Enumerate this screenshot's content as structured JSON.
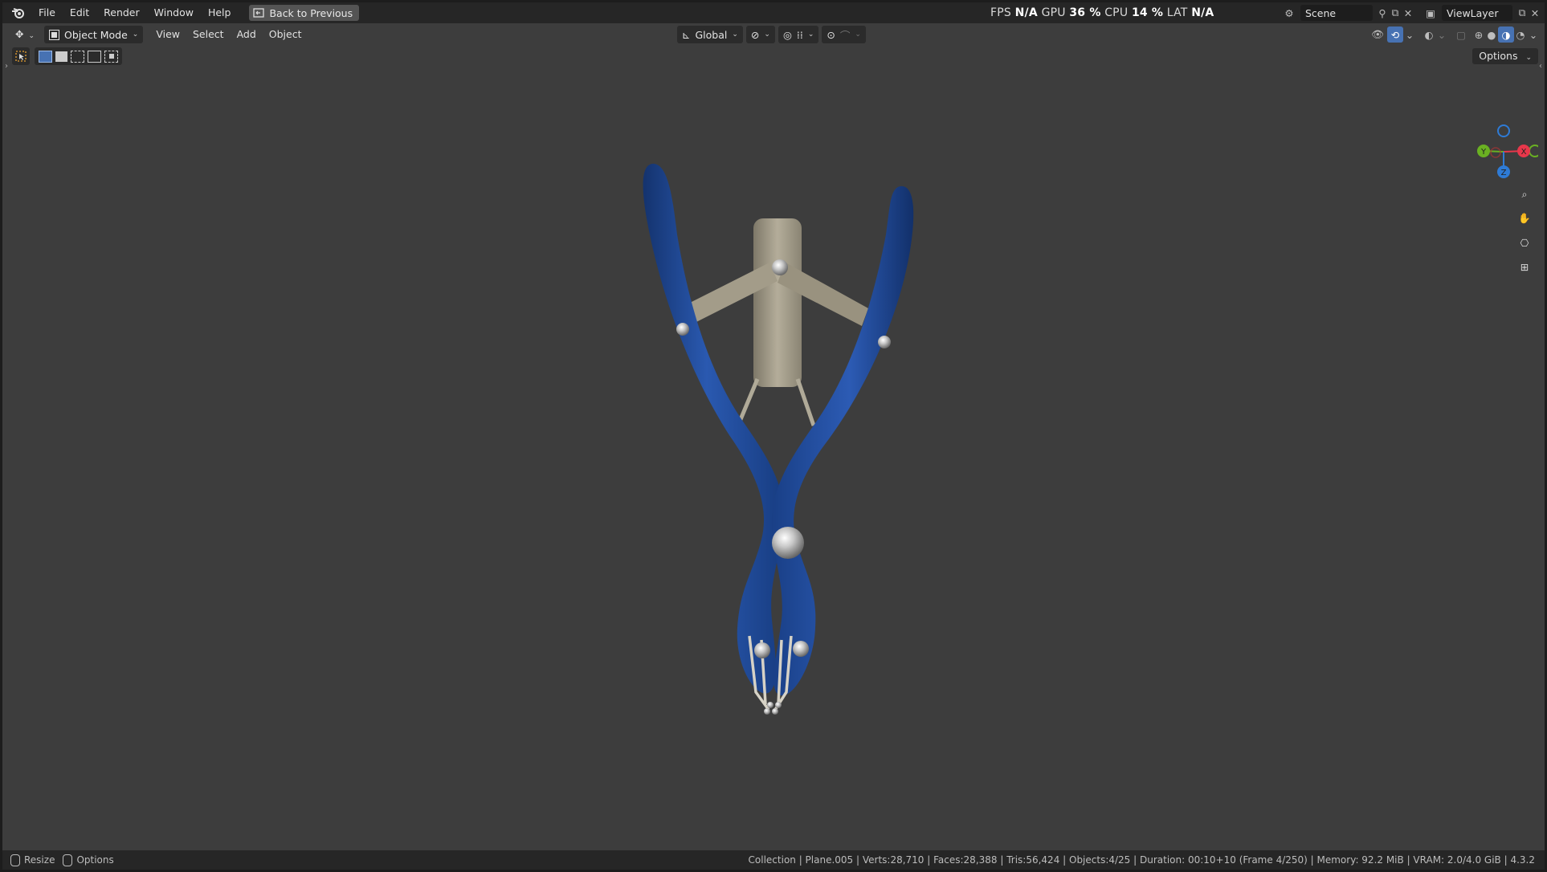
{
  "menubar": {
    "items": [
      "File",
      "Edit",
      "Render",
      "Window",
      "Help"
    ],
    "back_button": "Back to Previous",
    "scene_label": "Scene",
    "view_layer_label": "ViewLayer"
  },
  "performance": {
    "fps_label": "FPS",
    "fps_value": "N/A",
    "gpu_label": "GPU",
    "gpu_value": "36 %",
    "cpu_label": "CPU",
    "cpu_value": "14 %",
    "lat_label": "LAT",
    "lat_value": "N/A"
  },
  "header": {
    "mode": "Object Mode",
    "menus": [
      "View",
      "Select",
      "Add",
      "Object"
    ],
    "orientation": "Global",
    "options_label": "Options"
  },
  "gizmo": {
    "x_label": "X",
    "y_label": "Y",
    "z_label": "Z",
    "x_color": "#e8374b",
    "y_color": "#6ab122",
    "z_color": "#2e7bd6"
  },
  "model_colors": {
    "handles": "#1f4a9a",
    "metal": "#a9a290"
  },
  "statusbar": {
    "left_items": [
      "Resize",
      "Options"
    ],
    "info": "Collection | Plane.005 | Verts:28,710 | Faces:28,388 | Tris:56,424 | Objects:4/25 | Duration: 00:10+10 (Frame 4/250) | Memory: 92.2 MiB | VRAM: 2.0/4.0 GiB | 4.3.2"
  }
}
